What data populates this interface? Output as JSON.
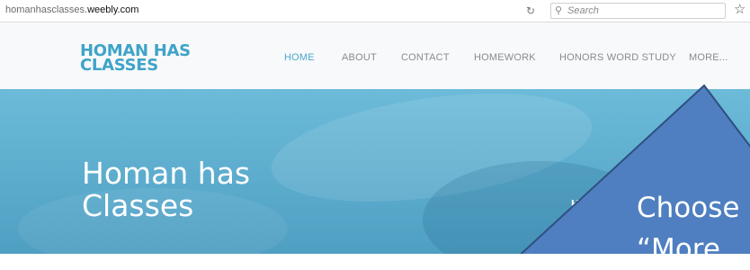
{
  "browser": {
    "url_prefix": "homanhasclasses.",
    "url_host": "weebly.com",
    "search_placeholder": "Search"
  },
  "site": {
    "logo_line1": "HOMAN HAS",
    "logo_line2": "CLASSES",
    "nav": [
      {
        "label": "HOME"
      },
      {
        "label": "ABOUT"
      },
      {
        "label": "CONTACT"
      },
      {
        "label": "HOMEWORK"
      },
      {
        "label": "HONORS WORD STUDY"
      },
      {
        "label": "MORE..."
      }
    ]
  },
  "hero": {
    "title_line1": "Homan has",
    "title_line2": "Classes",
    "fragment": "H"
  },
  "callout": {
    "line1": "Choose",
    "line2": "“More"
  },
  "colors": {
    "accent": "#4aa8cc",
    "logo": "#3fa3c9",
    "hero": "#5aaed0",
    "callout_fill": "#4f7fc0",
    "callout_border": "#2f4f80"
  }
}
